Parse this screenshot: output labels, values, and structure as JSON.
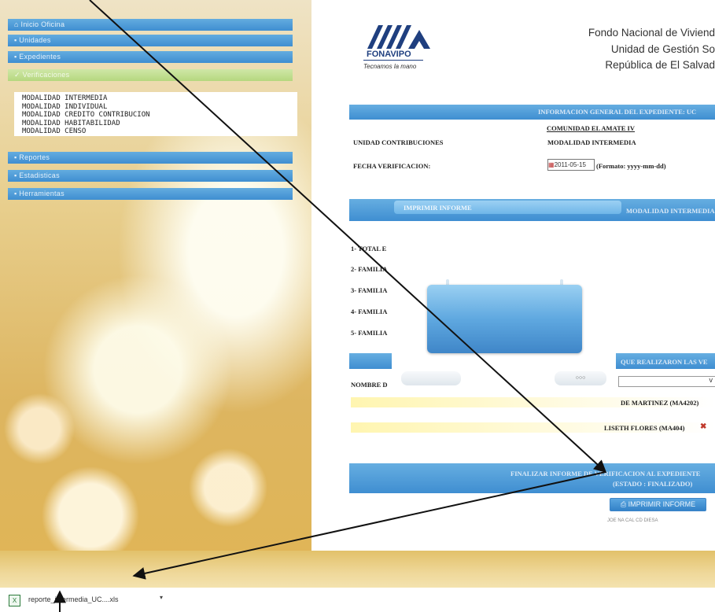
{
  "sidebar": {
    "top_item": "Inicio Oficina",
    "menus": [
      "Unidades",
      "Expedientes",
      "Verificaciones"
    ],
    "modalidades": [
      "MODALIDAD INTERMEDIA",
      "MODALIDAD INDIVIDUAL",
      "MODALIDAD CREDITO CONTRIBUCION",
      "MODALIDAD HABITABILIDAD",
      "MODALIDAD CENSO"
    ],
    "menus_bottom": [
      "Reportes",
      "Estadisticas",
      "Herramientas"
    ]
  },
  "logo": {
    "text": "FONAVIPO",
    "slogan": "Tecnamos la mano"
  },
  "header": {
    "line1": "Fondo Nacional de Viviend",
    "line2": "Unidad de Gestión So",
    "line3": "República de El Salvad"
  },
  "info": {
    "band_title": "INFORMACION GENERAL DEL EXPEDIENTE: UC",
    "community": "COMUNIDAD EL AMATE IV",
    "unit_label": "UNIDAD CONTRIBUCIONES",
    "modality": "MODALIDAD INTERMEDIA",
    "date_label": "FECHA VERIFICACION:",
    "date_value": "2011-05-15",
    "date_format": "(Formato: yyyy-mm-dd)"
  },
  "modal_band": {
    "left": "IMPRIMIR INFORME",
    "right": "MODALIDAD INTERMEDIA"
  },
  "families": [
    "1- TOTAL E",
    "2- FAMILIA",
    "3- FAMILIA",
    "4- FAMILIA",
    "5- FAMILIA"
  ],
  "verifiers": {
    "band": "QUE REALIZARON LAS VE",
    "name_label": "NOMBRE D",
    "verifier_1": "DE MARTINEZ (MA4202)",
    "verifier_2": "LISETH FLORES (MA404)"
  },
  "finalize": {
    "line1": "FINALIZAR INFORME DE VERIFICACION AL EXPEDIENTE",
    "line2": "(ESTADO : FINALIZADO)",
    "print_button": "IMPRIMIR INFORME",
    "footnote": "JOE NA CAL CD DIESA"
  },
  "download": {
    "filename": "reporte_intermedia_UC....xls"
  },
  "colors": {
    "accent_blue": "#3f8ed1",
    "sidebar_gold": "#ddb560",
    "arrow": "#111111"
  }
}
